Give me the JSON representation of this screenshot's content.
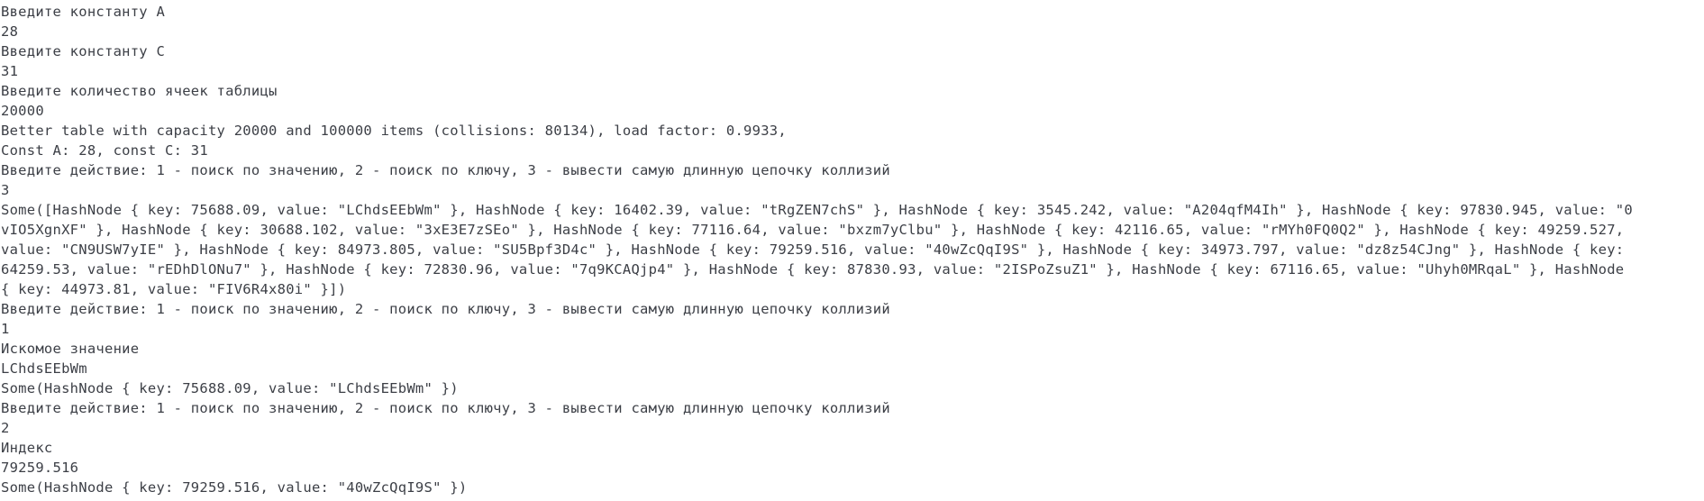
{
  "terminal": {
    "lines": [
      "Введите константу A",
      "28",
      "Введите константу C",
      "31",
      "Введите количество ячеек таблицы",
      "20000",
      "Better table with capacity 20000 and 100000 items (collisions: 80134), load factor: 0.9933,",
      "Const A: 28, const C: 31",
      "Введите действие: 1 - поиск по значению, 2 - поиск по ключу, 3 - вывести самую длинную цепочку коллизий",
      "3",
      "Some([HashNode { key: 75688.09, value: \"LChdsEEbWm\" }, HashNode { key: 16402.39, value: \"tRgZEN7chS\" }, HashNode { key: 3545.242, value: \"A204qfM4Ih\" }, HashNode { key: 97830.945, value: \"0",
      "vIO5XgnXF\" }, HashNode { key: 30688.102, value: \"3xE3E7zSEo\" }, HashNode { key: 77116.64, value: \"bxzm7yClbu\" }, HashNode { key: 42116.65, value: \"rMYh0FQ0Q2\" }, HashNode { key: 49259.527,",
      "value: \"CN9USW7yIE\" }, HashNode { key: 84973.805, value: \"SU5Bpf3D4c\" }, HashNode { key: 79259.516, value: \"40wZcQqI9S\" }, HashNode { key: 34973.797, value: \"dz8z54CJng\" }, HashNode { key:",
      "64259.53, value: \"rEDhDlONu7\" }, HashNode { key: 72830.96, value: \"7q9KCAQjp4\" }, HashNode { key: 87830.93, value: \"2ISPoZsuZ1\" }, HashNode { key: 67116.65, value: \"Uhyh0MRqaL\" }, HashNode",
      "{ key: 44973.81, value: \"FIV6R4x80i\" }])",
      "Введите действие: 1 - поиск по значению, 2 - поиск по ключу, 3 - вывести самую длинную цепочку коллизий",
      "1",
      "Искомое значение",
      "LChdsEEbWm",
      "Some(HashNode { key: 75688.09, value: \"LChdsEEbWm\" })",
      "Введите действие: 1 - поиск по значению, 2 - поиск по ключу, 3 - вывести самую длинную цепочку коллизий",
      "2",
      "Индекс",
      "79259.516",
      "Some(HashNode { key: 79259.516, value: \"40wZcQqI9S\" })"
    ]
  }
}
